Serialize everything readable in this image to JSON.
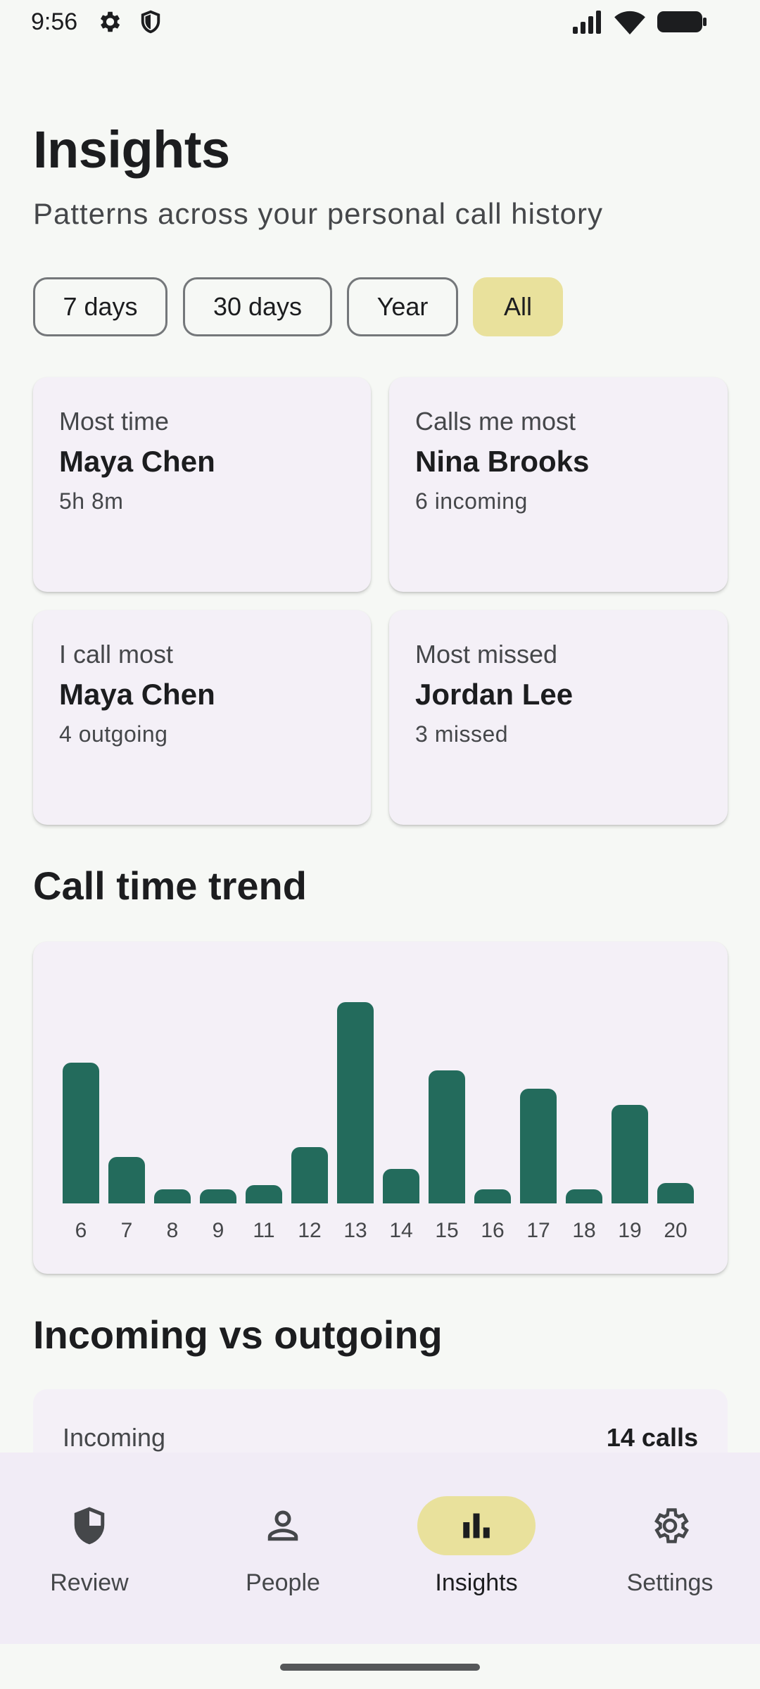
{
  "status_bar": {
    "time": "9:56",
    "icons": [
      "gear-icon",
      "shield-icon",
      "signal-icon",
      "wifi-icon",
      "battery-icon"
    ]
  },
  "header": {
    "title": "Insights",
    "subtitle": "Patterns across your personal call history"
  },
  "filters": [
    {
      "label": "7 days",
      "selected": false
    },
    {
      "label": "30 days",
      "selected": false
    },
    {
      "label": "Year",
      "selected": false
    },
    {
      "label": "All",
      "selected": true
    }
  ],
  "stat_cards": [
    {
      "label": "Most time",
      "name": "Maya Chen",
      "detail": "5h 8m"
    },
    {
      "label": "Calls me most",
      "name": "Nina Brooks",
      "detail": "6 incoming"
    },
    {
      "label": "I call most",
      "name": "Maya Chen",
      "detail": "4 outgoing"
    },
    {
      "label": "Most missed",
      "name": "Jordan Lee",
      "detail": "3 missed"
    }
  ],
  "trend_section": {
    "title": "Call time trend"
  },
  "chart_data": {
    "type": "bar",
    "title": "",
    "xlabel": "",
    "ylabel": "",
    "categories": [
      "6",
      "7",
      "8",
      "9",
      "11",
      "12",
      "13",
      "14",
      "15",
      "16",
      "17",
      "18",
      "19",
      "20"
    ],
    "values": [
      70,
      23,
      7,
      7,
      9,
      28,
      100,
      17,
      66,
      7,
      57,
      7,
      49,
      10
    ],
    "ylim": [
      0,
      100
    ],
    "grid": false,
    "color": "#236b5c"
  },
  "ratio_section": {
    "title": "Incoming vs outgoing",
    "incoming_label": "Incoming",
    "incoming_value": "14 calls"
  },
  "nav": [
    {
      "label": "Review",
      "icon": "shield-icon",
      "active": false
    },
    {
      "label": "People",
      "icon": "person-icon",
      "active": false
    },
    {
      "label": "Insights",
      "icon": "bar-chart-icon",
      "active": true
    },
    {
      "label": "Settings",
      "icon": "settings-icon",
      "active": false
    }
  ],
  "colors": {
    "accent": "#236b5c",
    "selected_chip": "#e9e19c",
    "card": "#f4f0f7",
    "background": "#f6f8f5"
  }
}
